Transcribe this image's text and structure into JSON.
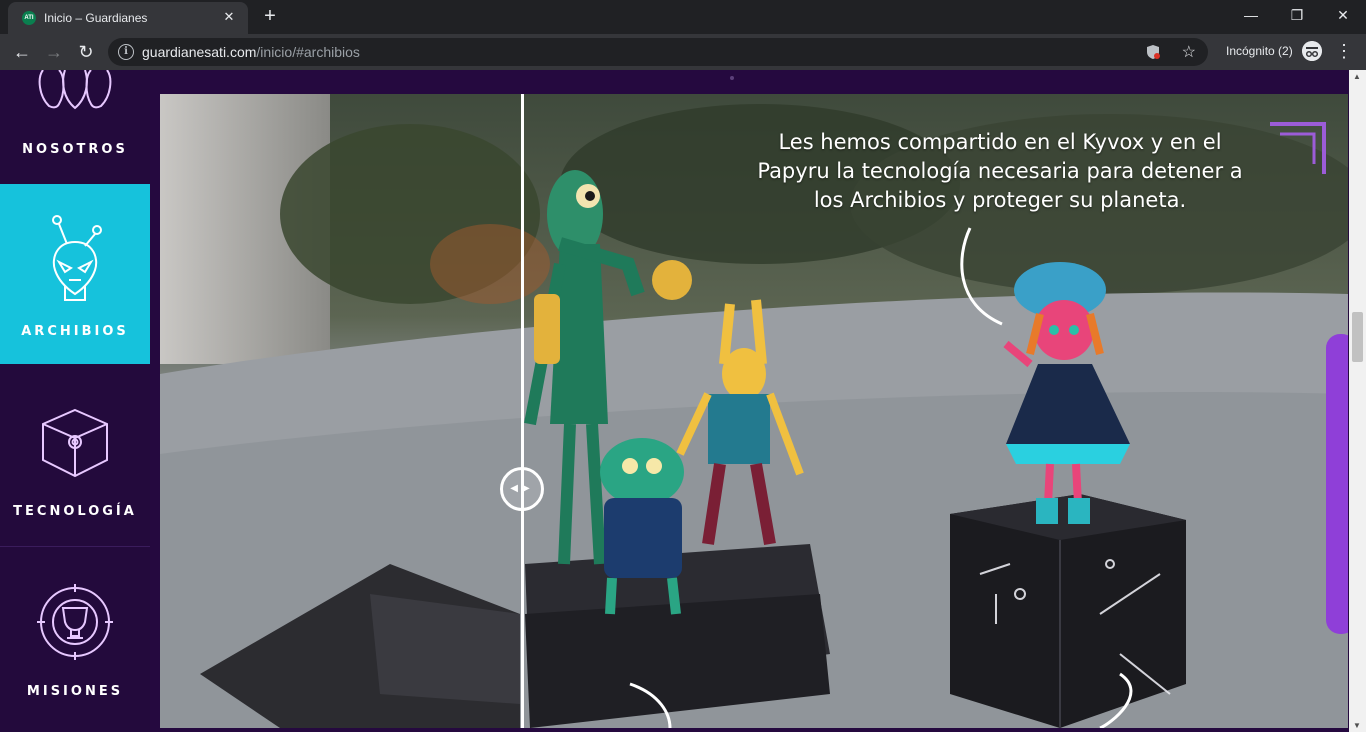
{
  "browser": {
    "tab": {
      "favicon_text": "ATI",
      "title": "Inicio – Guardianes",
      "close": "✕"
    },
    "new_tab": "+",
    "window": {
      "minimize": "—",
      "restore": "❐",
      "close": "✕"
    },
    "nav": {
      "back": "←",
      "forward": "→",
      "reload": "↻"
    },
    "address": {
      "info_icon": "i",
      "domain": "guardianesati.com",
      "path": "/inicio/#archibios"
    },
    "star": "☆",
    "incognito": "Incógnito (2)",
    "menu": "⋮"
  },
  "sidebar": {
    "items": [
      {
        "label": "NOSOTROS",
        "icon": "aliens-group-icon",
        "active": false
      },
      {
        "label": "ARCHIBIOS",
        "icon": "alien-head-icon",
        "active": true
      },
      {
        "label": "TECNOLOGÍA",
        "icon": "cube-icon",
        "active": false
      },
      {
        "label": "MISIONES",
        "icon": "trophy-target-icon",
        "active": false
      }
    ]
  },
  "viewer": {
    "speech": "Les hemos compartido en el Kyvox y en el Papyru la tecnología necesaria para detener a los Archibios y proteger su planeta.",
    "compare_handle": "◀▶"
  },
  "colors": {
    "accent": "#16c2dc",
    "sidebar_bg": "#230a3c",
    "page_bg": "#25093f"
  }
}
